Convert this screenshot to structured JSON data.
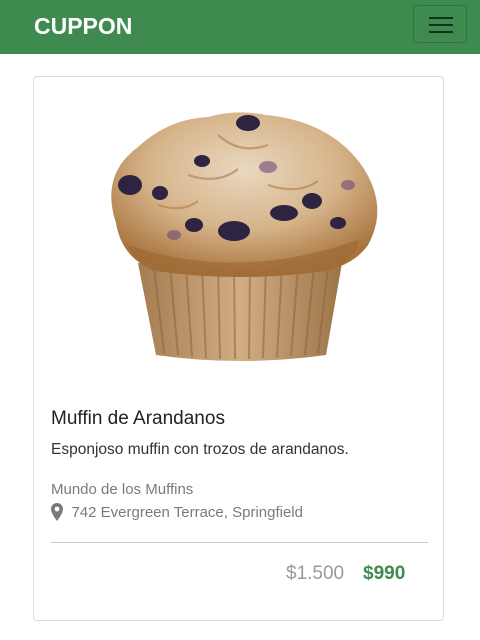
{
  "navbar": {
    "brand": "CUPPON",
    "toggler_icon": "hamburger-menu-icon",
    "background_color": "#3e8a4f"
  },
  "product": {
    "image": "blueberry-muffin-image",
    "title": "Muffin de Arandanos",
    "description": "Esponjoso muffin con trozos de arandanos.",
    "store": "Mundo de los Muffins",
    "location_icon": "map-pin-icon",
    "address": "742 Evergreen Terrace, Springfield",
    "original_price": "$1.500",
    "discount_price": "$990",
    "discount_color": "#3e8a4f"
  }
}
